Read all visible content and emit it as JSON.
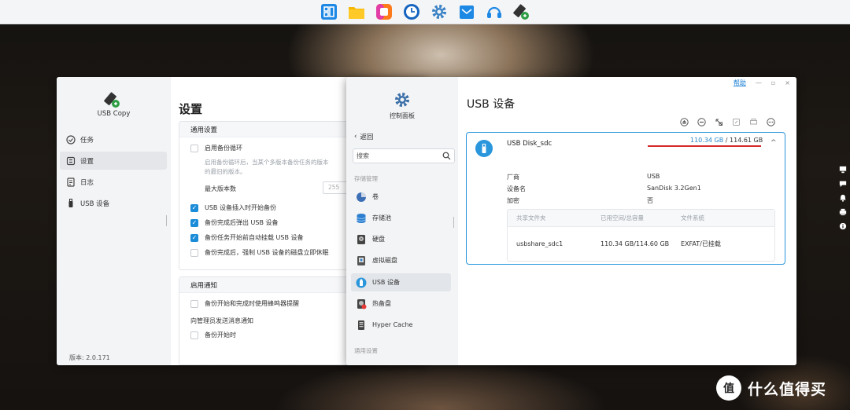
{
  "dock": {
    "icons": [
      "window-manager-icon",
      "folder-icon",
      "photo-app-icon",
      "clock-icon",
      "settings-gear-icon",
      "mail-icon",
      "headset-icon",
      "usb-copy-icon"
    ]
  },
  "usb_copy": {
    "app_name": "USB Copy",
    "nav": [
      {
        "label": "任务",
        "icon": "task-icon",
        "active": false
      },
      {
        "label": "设置",
        "icon": "settings-icon",
        "active": true
      },
      {
        "label": "日志",
        "icon": "log-icon",
        "active": false
      },
      {
        "label": "USB 设备",
        "icon": "usb-icon",
        "active": false
      }
    ],
    "version": "版本: 2.0.171",
    "main": {
      "title": "设置",
      "general": {
        "header": "通用设置",
        "enable_cycle": "启用备份循环",
        "enable_cycle_desc1": "启用备份循环后，当某个多版本备份任务的版本",
        "enable_cycle_desc2": "的最旧的版本。",
        "max_versions_label": "最大版本数",
        "max_versions_value": "255",
        "opt_auto_start": "USB 设备插入时开始备份",
        "opt_eject": "备份完成后弹出 USB 设备",
        "opt_mount": "备份任务开始前自动挂载 USB 设备",
        "opt_force_unmount": "备份完成后，强制 USB 设备的磁盘立即休眠"
      },
      "notify": {
        "header": "启用通知",
        "opt_beep": "备份开始和完成时使用蜂鸣器提醒",
        "send_label": "向管理员发送消息通知",
        "opt_backup_start": "备份开始时"
      }
    }
  },
  "control_panel": {
    "app_name": "控制面板",
    "back_label": "返回",
    "search_placeholder": "搜索",
    "section_storage": "存储管理",
    "nav": [
      {
        "label": "卷",
        "icon": "volume-icon"
      },
      {
        "label": "存储池",
        "icon": "storage-pool-icon"
      },
      {
        "label": "硬盘",
        "icon": "hard-disk-icon"
      },
      {
        "label": "虚拟磁盘",
        "icon": "virtual-disk-icon"
      },
      {
        "label": "USB 设备",
        "icon": "usb-device-icon"
      },
      {
        "label": "热备盘",
        "icon": "hot-spare-icon"
      },
      {
        "label": "Hyper Cache",
        "icon": "hyper-cache-icon"
      }
    ],
    "section_general": "通用设置",
    "help_label": "帮助",
    "title": "USB 设备",
    "device": {
      "name": "USB Disk_sdc",
      "used": "110.34 GB",
      "separator": " / ",
      "total": "114.61 GB",
      "vendor_label": "厂商",
      "vendor_value": "USB",
      "model_label": "设备名",
      "model_value": "SanDisk 3.2Gen1",
      "encrypt_label": "加密",
      "encrypt_value": "否",
      "table": {
        "columns": [
          "共享文件夹",
          "已用空间/总容量",
          "文件系统"
        ],
        "rows": [
          [
            "usbshare_sdc1",
            "110.34 GB/114.60 GB",
            "EXFAT/已挂载"
          ]
        ]
      }
    }
  },
  "watermark": {
    "logo_char": "值",
    "text": "什么值得买"
  },
  "colors": {
    "accent": "#2a96dc",
    "checkbox": "#1a8cd8",
    "underline": "#d62828"
  }
}
